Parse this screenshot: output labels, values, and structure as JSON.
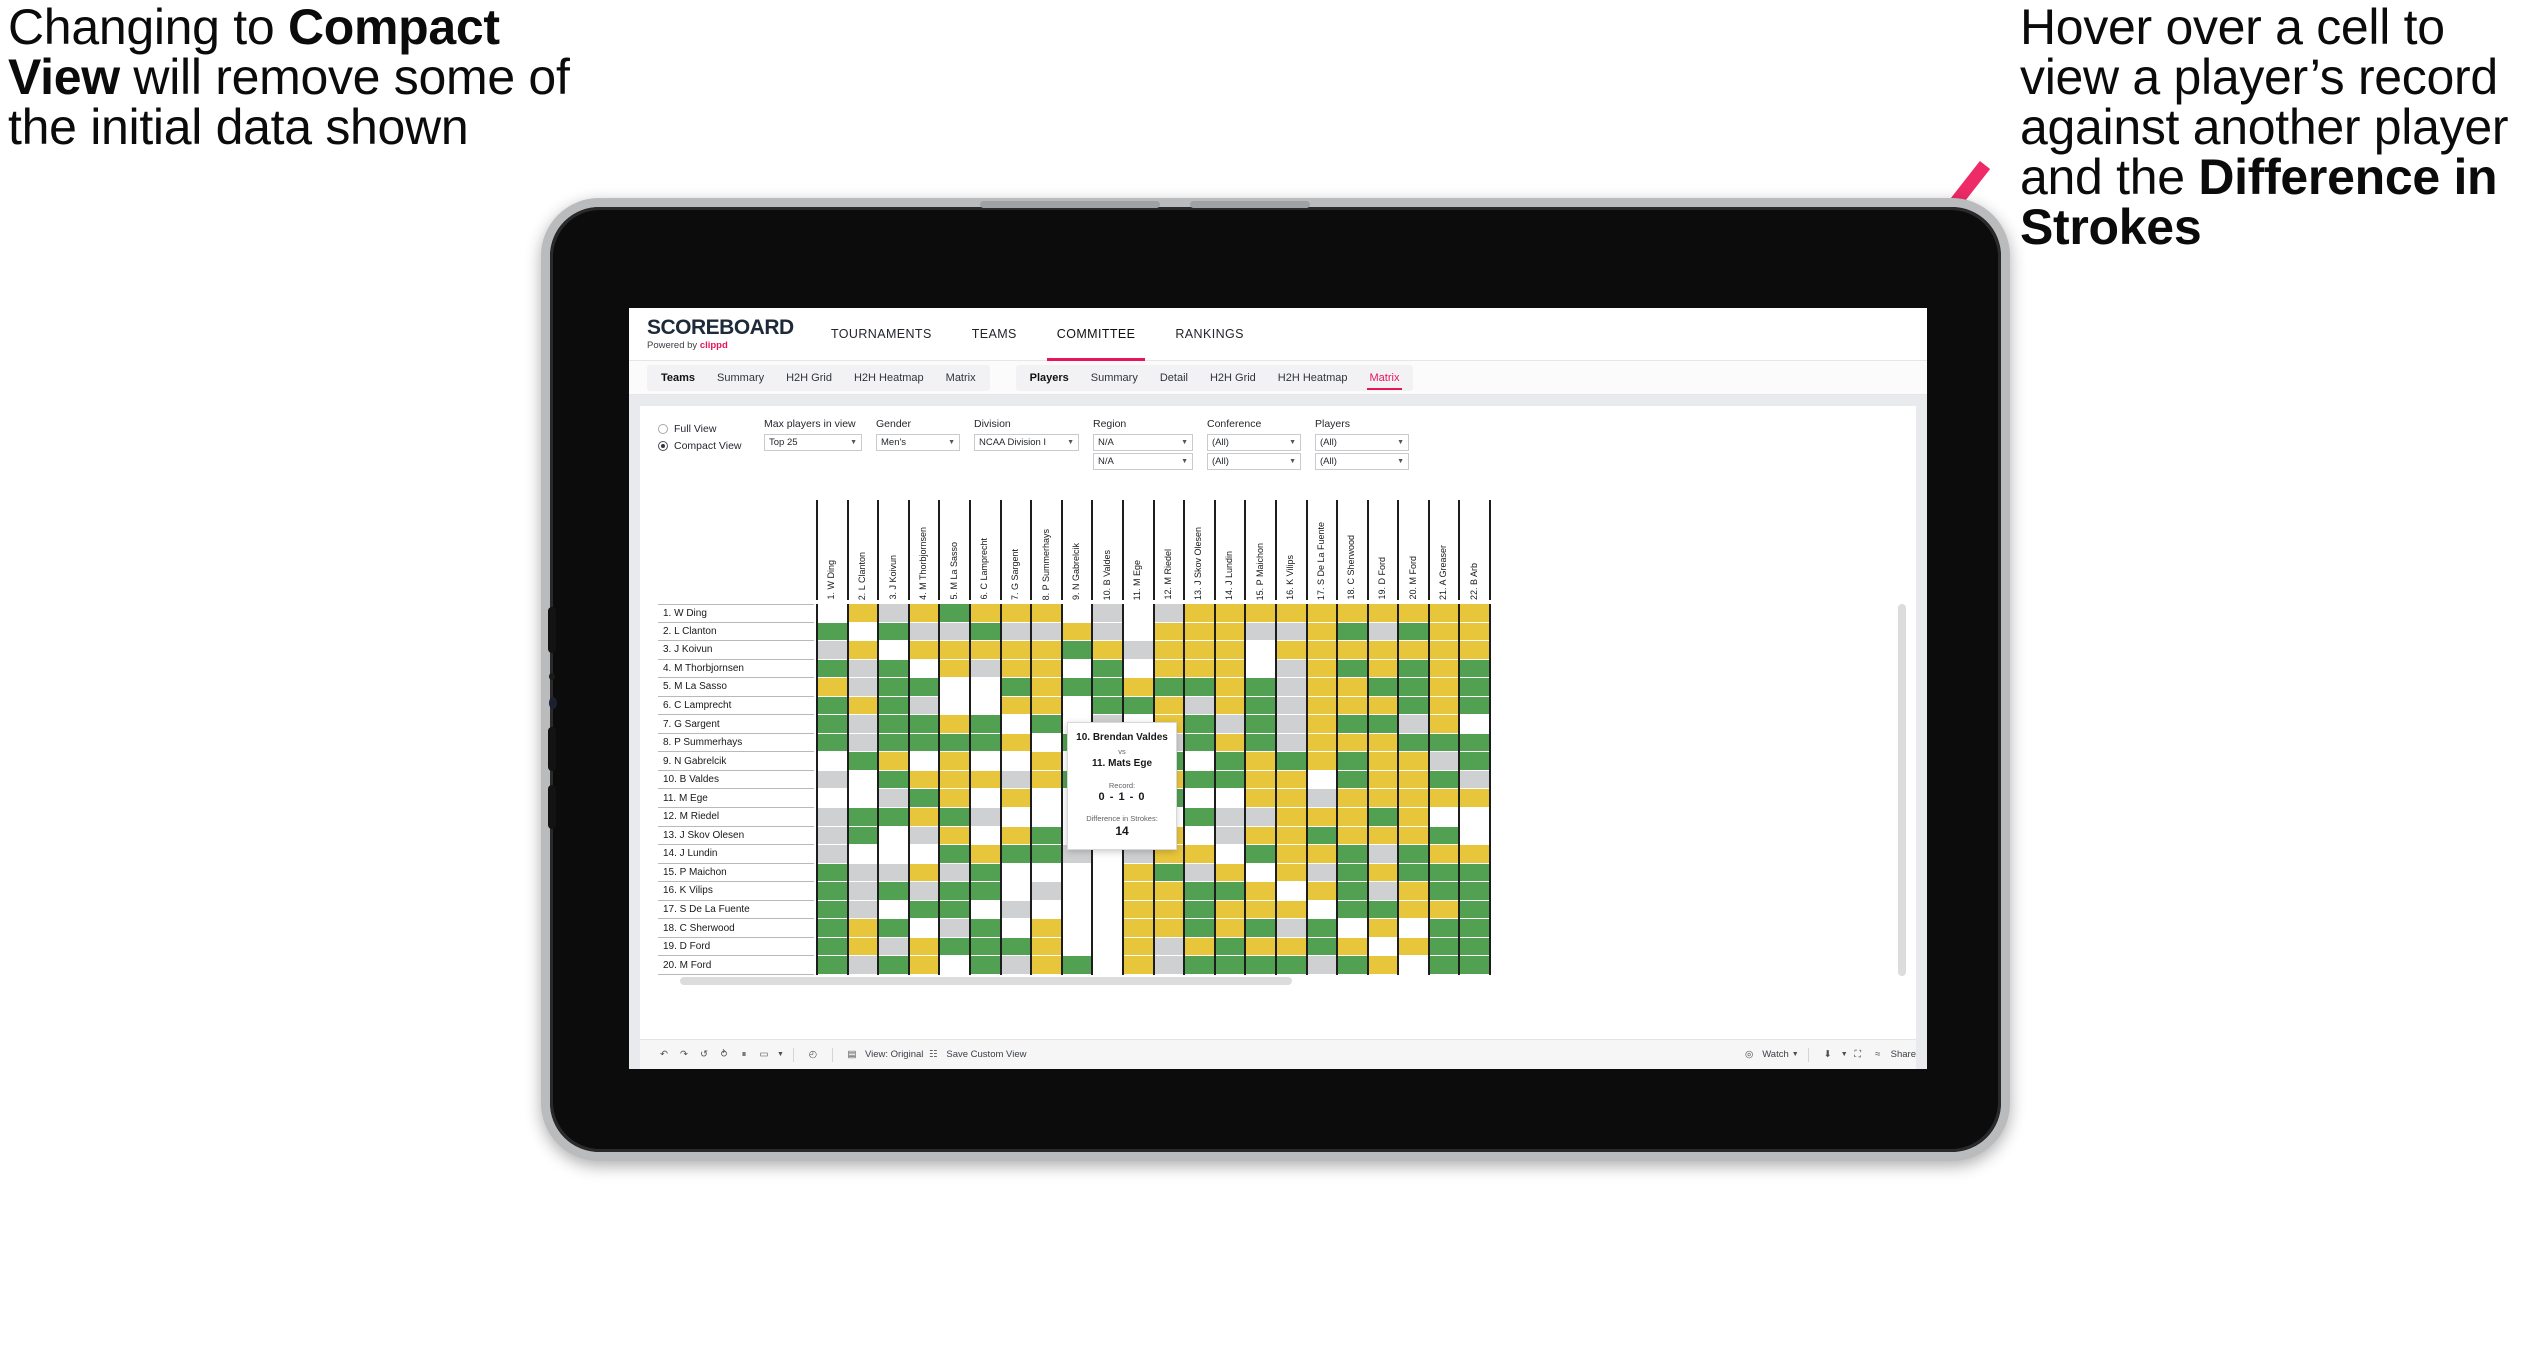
{
  "annotations": {
    "left": {
      "parts": [
        {
          "text": "Changing to ",
          "bold": false
        },
        {
          "text": "Compact View",
          "bold": true
        },
        {
          "text": " will remove some of the initial data shown",
          "bold": false
        }
      ]
    },
    "right": {
      "parts": [
        {
          "text": "Hover over a cell to view a player’s record against another player and the ",
          "bold": false
        },
        {
          "text": "Difference in Strokes",
          "bold": true
        }
      ]
    },
    "arrow_color": "#ee2a68"
  },
  "brand": {
    "logo_text": "SCOREBOARD",
    "powered_prefix": "Powered by ",
    "powered_brand": "clippd",
    "accent": "#e8145a"
  },
  "topnav": [
    {
      "label": "TOURNAMENTS",
      "active": false
    },
    {
      "label": "TEAMS",
      "active": false
    },
    {
      "label": "COMMITTEE",
      "active": true
    },
    {
      "label": "RANKINGS",
      "active": false
    }
  ],
  "subnav": {
    "group_teams": [
      {
        "label": "Teams",
        "head": true,
        "active": false
      },
      {
        "label": "Summary",
        "head": false,
        "active": false
      },
      {
        "label": "H2H Grid",
        "head": false,
        "active": false
      },
      {
        "label": "H2H Heatmap",
        "head": false,
        "active": false
      },
      {
        "label": "Matrix",
        "head": false,
        "active": false
      }
    ],
    "group_players": [
      {
        "label": "Players",
        "head": true,
        "active": false
      },
      {
        "label": "Summary",
        "head": false,
        "active": false
      },
      {
        "label": "Detail",
        "head": false,
        "active": false
      },
      {
        "label": "H2H Grid",
        "head": false,
        "active": false
      },
      {
        "label": "H2H Heatmap",
        "head": false,
        "active": false
      },
      {
        "label": "Matrix",
        "head": false,
        "active": true
      }
    ]
  },
  "filters": {
    "view_options": [
      {
        "label": "Full View",
        "selected": false
      },
      {
        "label": "Compact View",
        "selected": true
      }
    ],
    "fields": [
      {
        "label": "Max players in view",
        "values": [
          "Top 25"
        ],
        "width_class": "w-maxp"
      },
      {
        "label": "Gender",
        "values": [
          "Men's"
        ],
        "width_class": "w-gender"
      },
      {
        "label": "Division",
        "values": [
          "NCAA Division I"
        ],
        "width_class": "w-div"
      },
      {
        "label": "Region",
        "values": [
          "N/A",
          "N/A"
        ],
        "width_class": "w-region"
      },
      {
        "label": "Conference",
        "values": [
          "(All)",
          "(All)"
        ],
        "width_class": "w-conf"
      },
      {
        "label": "Players",
        "values": [
          "(All)",
          "(All)"
        ],
        "width_class": "w-players"
      }
    ]
  },
  "matrix": {
    "columns": [
      "1. W Ding",
      "2. L Clanton",
      "3. J Koivun",
      "4. M Thorbjornsen",
      "5. M La Sasso",
      "6. C Lamprecht",
      "7. G Sargent",
      "8. P Summerhays",
      "9. N Gabrelcik",
      "10. B Valdes",
      "11. M Ege",
      "12. M Riedel",
      "13. J Skov Olesen",
      "14. J Lundin",
      "15. P Maichon",
      "16. K Vilips",
      "17. S De La Fuente",
      "18. C Sherwood",
      "19. D Ford",
      "20. M Ford",
      "21. A Greaser",
      "22. B Arb"
    ],
    "rows": [
      "1. W Ding",
      "2. L Clanton",
      "3. J Koivun",
      "4. M Thorbjornsen",
      "5. M La Sasso",
      "6. C Lamprecht",
      "7. G Sargent",
      "8. P Summerhays",
      "9. N Gabrelcik",
      "10. B Valdes",
      "11. M Ege",
      "12. M Riedel",
      "13. J Skov Olesen",
      "14. J Lundin",
      "15. P Maichon",
      "16. K Vilips",
      "17. S De La Fuente",
      "18. C Sherwood",
      "19. D Ford",
      "20. M Ford"
    ],
    "legend": {
      "win": "#52a052",
      "loss": "#e8c63c",
      "tie": "#cfd0d1",
      "none": "#ffffff"
    },
    "cells": [
      [
        "w",
        "y",
        "a",
        "y",
        "g",
        "y",
        "y",
        "y",
        "w",
        "a",
        "w",
        "a",
        "y",
        "y",
        "y",
        "y",
        "y",
        "y",
        "y",
        "y",
        "y",
        "y"
      ],
      [
        "g",
        "w",
        "g",
        "a",
        "a",
        "g",
        "a",
        "a",
        "y",
        "a",
        "w",
        "y",
        "y",
        "y",
        "a",
        "a",
        "y",
        "g",
        "a",
        "g",
        "y",
        "y"
      ],
      [
        "a",
        "y",
        "w",
        "y",
        "y",
        "y",
        "y",
        "y",
        "g",
        "y",
        "a",
        "y",
        "y",
        "y",
        "w",
        "y",
        "y",
        "y",
        "y",
        "y",
        "y",
        "y"
      ],
      [
        "g",
        "a",
        "g",
        "w",
        "y",
        "a",
        "y",
        "y",
        "w",
        "g",
        "w",
        "y",
        "y",
        "y",
        "w",
        "a",
        "y",
        "g",
        "y",
        "g",
        "y",
        "g"
      ],
      [
        "y",
        "a",
        "g",
        "g",
        "w",
        "w",
        "g",
        "y",
        "g",
        "g",
        "y",
        "g",
        "g",
        "y",
        "g",
        "a",
        "y",
        "y",
        "g",
        "g",
        "y",
        "g"
      ],
      [
        "g",
        "y",
        "g",
        "a",
        "w",
        "w",
        "y",
        "y",
        "w",
        "g",
        "g",
        "y",
        "a",
        "y",
        "g",
        "a",
        "y",
        "y",
        "y",
        "g",
        "y",
        "g"
      ],
      [
        "g",
        "a",
        "g",
        "g",
        "y",
        "g",
        "w",
        "g",
        "w",
        "a",
        "w",
        "y",
        "g",
        "a",
        "g",
        "a",
        "y",
        "g",
        "g",
        "a",
        "y",
        "w"
      ],
      [
        "g",
        "a",
        "g",
        "g",
        "g",
        "g",
        "y",
        "w",
        "g",
        "g",
        "w",
        "a",
        "g",
        "y",
        "g",
        "a",
        "y",
        "y",
        "y",
        "g",
        "g",
        "g"
      ],
      [
        "w",
        "g",
        "y",
        "w",
        "y",
        "w",
        "w",
        "y",
        "w",
        "y",
        "a",
        "g",
        "w",
        "g",
        "y",
        "g",
        "y",
        "g",
        "y",
        "y",
        "a",
        "g"
      ],
      [
        "a",
        "w",
        "g",
        "y",
        "y",
        "y",
        "a",
        "y",
        "g",
        "w",
        "w",
        "y",
        "g",
        "g",
        "y",
        "y",
        "w",
        "g",
        "y",
        "y",
        "g",
        "a"
      ],
      [
        "w",
        "w",
        "a",
        "g",
        "y",
        "w",
        "y",
        "w",
        "w",
        "w",
        "w",
        "g",
        "w",
        "w",
        "y",
        "y",
        "a",
        "y",
        "y",
        "y",
        "y",
        "y"
      ],
      [
        "a",
        "g",
        "g",
        "y",
        "g",
        "a",
        "w",
        "w",
        "w",
        "w",
        "y",
        "w",
        "g",
        "a",
        "a",
        "y",
        "y",
        "y",
        "g",
        "y",
        "w",
        "w"
      ],
      [
        "a",
        "g",
        "w",
        "a",
        "y",
        "w",
        "y",
        "g",
        "w",
        "w",
        "y",
        "y",
        "w",
        "a",
        "y",
        "y",
        "g",
        "y",
        "y",
        "y",
        "g",
        "w"
      ],
      [
        "a",
        "w",
        "w",
        "w",
        "g",
        "y",
        "g",
        "g",
        "a",
        "w",
        "a",
        "y",
        "y",
        "w",
        "g",
        "y",
        "y",
        "g",
        "a",
        "g",
        "y",
        "y"
      ],
      [
        "g",
        "a",
        "a",
        "y",
        "a",
        "g",
        "w",
        "w",
        "w",
        "w",
        "y",
        "g",
        "a",
        "y",
        "w",
        "y",
        "a",
        "g",
        "y",
        "g",
        "g",
        "g"
      ],
      [
        "g",
        "a",
        "g",
        "a",
        "g",
        "g",
        "w",
        "a",
        "w",
        "w",
        "y",
        "y",
        "g",
        "g",
        "y",
        "w",
        "y",
        "g",
        "a",
        "y",
        "g",
        "g"
      ],
      [
        "g",
        "a",
        "w",
        "g",
        "g",
        "w",
        "a",
        "w",
        "w",
        "w",
        "y",
        "y",
        "g",
        "y",
        "y",
        "y",
        "w",
        "g",
        "g",
        "y",
        "y",
        "g"
      ],
      [
        "g",
        "y",
        "g",
        "w",
        "a",
        "g",
        "w",
        "y",
        "w",
        "w",
        "y",
        "y",
        "g",
        "y",
        "g",
        "a",
        "g",
        "w",
        "y",
        "w",
        "g",
        "g"
      ],
      [
        "g",
        "y",
        "a",
        "y",
        "g",
        "g",
        "g",
        "y",
        "w",
        "w",
        "y",
        "a",
        "y",
        "g",
        "y",
        "y",
        "g",
        "y",
        "w",
        "y",
        "g",
        "g"
      ],
      [
        "g",
        "a",
        "g",
        "y",
        "w",
        "g",
        "a",
        "y",
        "g",
        "w",
        "y",
        "a",
        "g",
        "g",
        "g",
        "g",
        "a",
        "g",
        "y",
        "w",
        "g",
        "g"
      ]
    ]
  },
  "tooltip": {
    "player_a": "10. Brendan Valdes",
    "vs": "vs",
    "player_b": "11. Mats Ege",
    "record_label": "Record:",
    "record_value": "0 - 1 - 0",
    "strokes_label": "Difference in Strokes:",
    "strokes_value": "14"
  },
  "toolbar": {
    "items": [
      {
        "name": "undo-icon",
        "glyph": "↶",
        "label": ""
      },
      {
        "name": "redo-icon",
        "glyph": "↷",
        "label": ""
      },
      {
        "name": "revert-icon",
        "glyph": "↺",
        "label": ""
      },
      {
        "name": "refresh-icon",
        "glyph": "⥁",
        "label": ""
      },
      {
        "name": "pause-icon",
        "glyph": "⏸",
        "label": ""
      },
      {
        "name": "highlight-icon",
        "glyph": "▭",
        "label": "",
        "caret": true
      },
      {
        "sep": true
      },
      {
        "name": "history-icon",
        "glyph": "◴",
        "label": ""
      },
      {
        "sep": true
      },
      {
        "name": "view-original-icon",
        "glyph": "▤",
        "label": "View: Original"
      },
      {
        "name": "save-custom-view-icon",
        "glyph": "☷",
        "label": "Save Custom View"
      },
      {
        "spacer": true
      },
      {
        "name": "watch-icon",
        "glyph": "◎",
        "label": "Watch",
        "caret": true
      },
      {
        "sep": true
      },
      {
        "name": "download-icon",
        "glyph": "⬇",
        "label": "",
        "caret": true
      },
      {
        "name": "fullscreen-icon",
        "glyph": "⛶",
        "label": ""
      },
      {
        "name": "share-icon",
        "glyph": "≈",
        "label": "Share"
      }
    ]
  }
}
